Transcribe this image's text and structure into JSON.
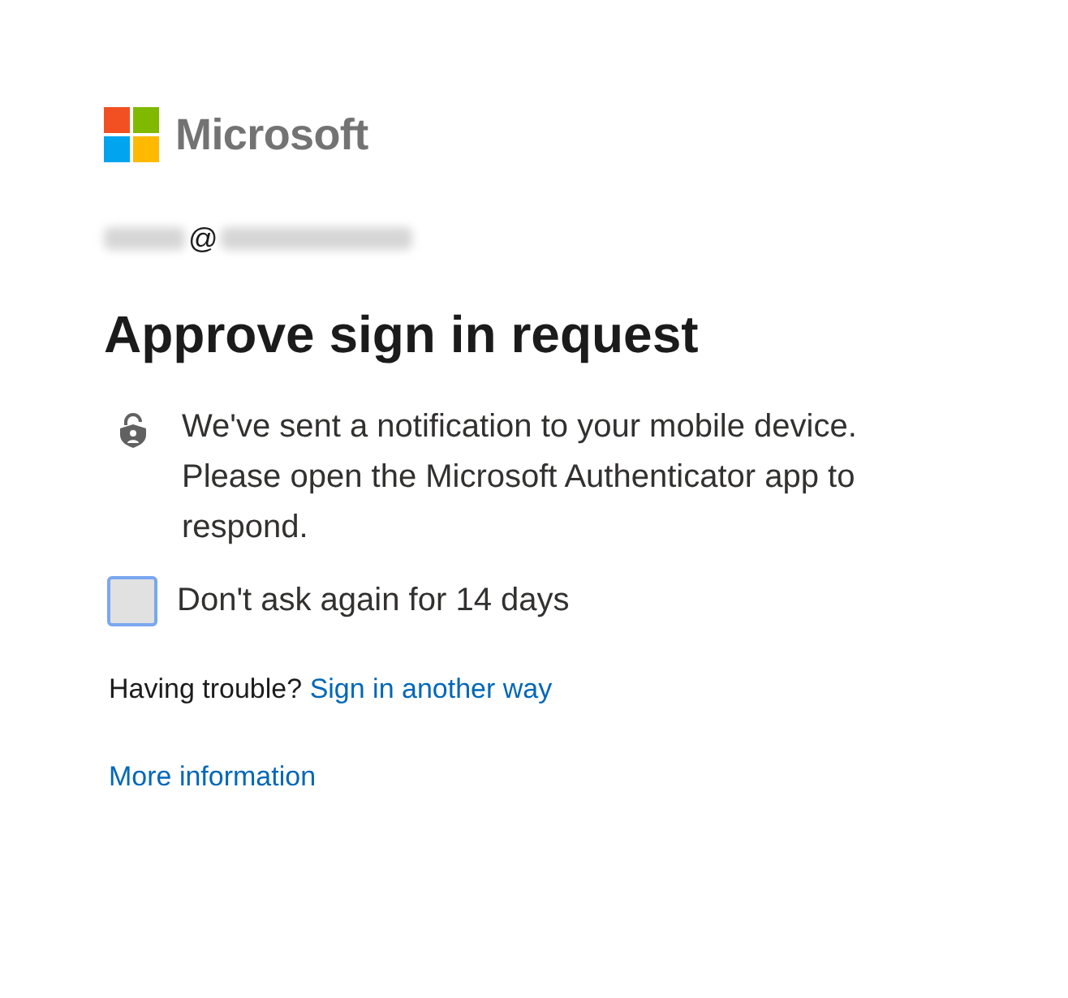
{
  "logo": {
    "text": "Microsoft"
  },
  "account": {
    "email_visible": "@"
  },
  "title": "Approve sign in request",
  "message": "We've sent a notification to your mobile device. Please open the Microsoft Authenticator app to respond.",
  "remember": {
    "label": "Don't ask again for 14 days",
    "checked": false,
    "focused": true
  },
  "help": {
    "prompt": "Having trouble?",
    "link": "Sign in another way"
  },
  "more_link": "More information"
}
